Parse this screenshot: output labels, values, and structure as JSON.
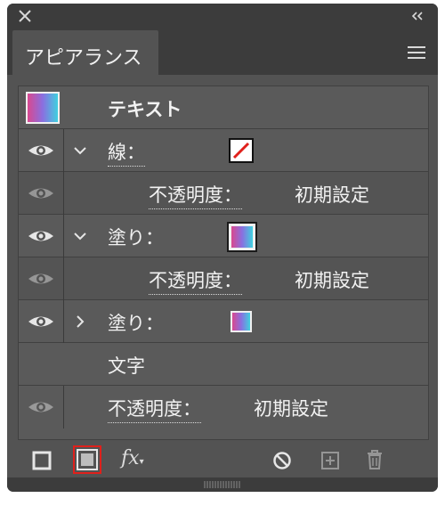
{
  "panel": {
    "tab_label": "アピアランス",
    "icons": {
      "close": "close-icon",
      "collapse": "double-chevron-left-icon",
      "menu": "hamburger-menu-icon"
    }
  },
  "rows": {
    "text_object": {
      "label": "テキスト"
    },
    "stroke": {
      "label": "線：",
      "swatch": "none"
    },
    "stroke_opacity": {
      "label": "不透明度：",
      "value": "初期設定"
    },
    "fill1": {
      "label": "塗り："
    },
    "fill1_opacity": {
      "label": "不透明度：",
      "value": "初期設定"
    },
    "fill2": {
      "label": "塗り："
    },
    "characters": {
      "label": "文字"
    },
    "opacity": {
      "label": "不透明度：",
      "value": "初期設定"
    }
  },
  "colors": {
    "panel_bg": "#535353",
    "row_bg": "#5a5a5a",
    "highlight": "#e0201b",
    "gradient": [
      "#d9488f",
      "#8a6fe0",
      "#3fd1df"
    ]
  },
  "toolbar": {
    "icons": [
      "add-new-stroke-icon",
      "add-new-fill-icon",
      "fx-effect-icon",
      "clear-appearance-icon",
      "duplicate-item-icon",
      "delete-icon"
    ],
    "fx_label": "fx"
  }
}
